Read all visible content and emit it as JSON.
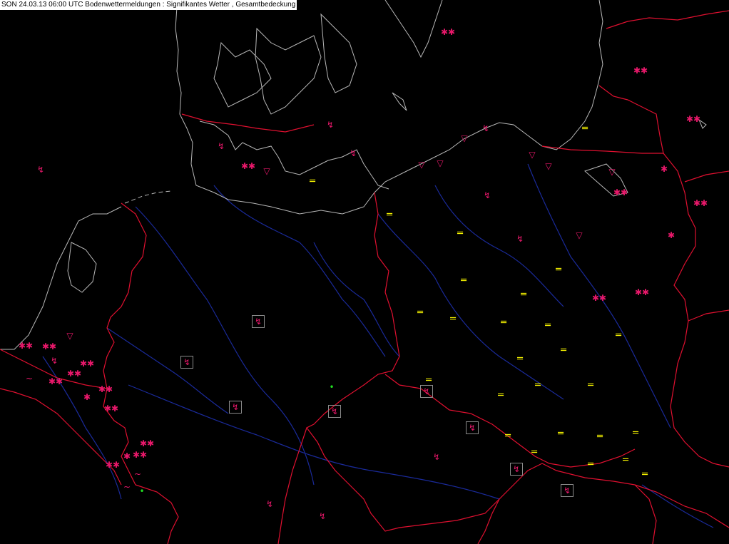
{
  "title": "SON 24.03.13 06:00 UTC  Bodenwettermeldungen :  Signifikantes Wetter , Gesamtbedeckung",
  "colors": {
    "coast": "#b8b8b8",
    "border": "#e01030",
    "river": "#1a2a9a",
    "symbol": "#e8186a",
    "fog": "#f5f200",
    "rain": "#22dd22",
    "box": "#8a8a8a"
  },
  "symbols": {
    "snow": "✱✱",
    "snow_single": "✱",
    "fog": "═",
    "thunder": "↯",
    "shower": "▽",
    "drizzle": "~",
    "rain_dot": "•"
  }
}
